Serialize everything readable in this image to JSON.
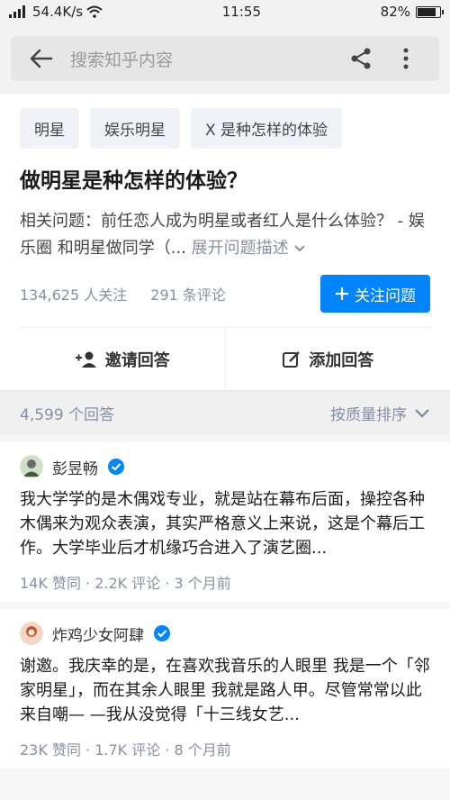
{
  "status_bar": {
    "signal": "⁴ᴳ",
    "speed": "54.4K/s",
    "time": "11:55",
    "battery": "82%",
    "battery_level": 0.82
  },
  "search": {
    "placeholder": "搜索知乎内容"
  },
  "question": {
    "tags": [
      "明星",
      "娱乐明星",
      "X 是种怎样的体验"
    ],
    "title": "做明星是种怎样的体验？",
    "description": "相关问题：前任恋人成为明星或者红人是什么体验？ - 娱乐圈 和明星做同学（...",
    "expand_label": "展开问题描述",
    "followers": "134,625 人关注",
    "comments": "291 条评论",
    "follow_button": "关注问题",
    "invite_label": "邀请回答",
    "add_answer_label": "添加回答"
  },
  "answers_header": {
    "count": "4,599 个回答",
    "sort": "按质量排序"
  },
  "answers": [
    {
      "author": "彭昱畅",
      "excerpt": "我大学学的是木偶戏专业，就是站在幕布后面，操控各种木偶来为观众表演，其实严格意义上来说，这是个幕后工作。大学毕业后才机缘巧合进入了演艺圈...",
      "meta": "14K 赞同 · 2.2K 评论 · 3 个月前"
    },
    {
      "author": "炸鸡少女阿肆",
      "excerpt": "谢邀。我庆幸的是，在喜欢我音乐的人眼里 我是一个「邻家明星」，而在其余人眼里 我就是路人甲。尽管常常以此来自嘲— —我从没觉得「十三线女艺...",
      "meta": "23K 赞同 · 1.7K 评论 · 8 个月前"
    }
  ],
  "colors": {
    "accent": "#0084ff",
    "meta": "#8590a6"
  }
}
